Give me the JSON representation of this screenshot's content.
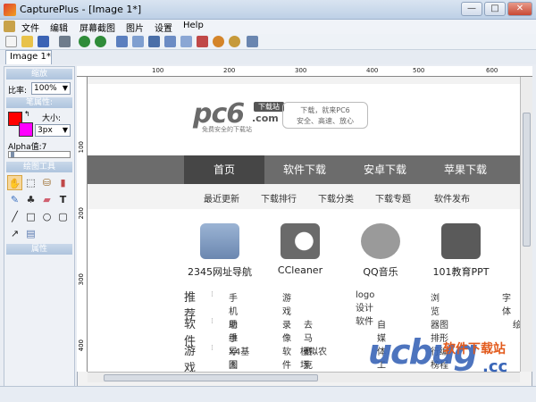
{
  "window": {
    "title": "CapturePlus - [Image 1*]",
    "min": "—",
    "max": "□",
    "close": "✕"
  },
  "menu": [
    "文件",
    "编辑",
    "屏幕截图",
    "图片",
    "设置",
    "Help"
  ],
  "tab": {
    "label": "Image 1*"
  },
  "panel": {
    "zoom_section": "缩放",
    "zoom_label": "比率:",
    "zoom_value": "100%",
    "props_section": "笔属性:",
    "size_label": "大小:",
    "size_value": "3px",
    "alpha_label": "Alpha值:7",
    "tools_section": "绘图工具",
    "attr_section": "属性"
  },
  "rulers": {
    "top": [
      "100",
      "200",
      "300",
      "400",
      "500",
      "600"
    ],
    "left": [
      "100",
      "200",
      "300",
      "400"
    ]
  },
  "colors": {
    "primary": "#ff0000",
    "secondary": "#ff00ff"
  },
  "page": {
    "logo": "pc6",
    "logo_badge": "下载站",
    "logo_com": ".com",
    "logo_slogan": "免费安全的下载站",
    "slogan_line1": "下载，就来PC6",
    "slogan_line2": "安全、高速、放心",
    "nav": [
      "首页",
      "软件下载",
      "安卓下载",
      "苹果下载"
    ],
    "subnav": [
      "最近更新",
      "下载排行",
      "下载分类",
      "下载专题",
      "软件发布"
    ],
    "apps": [
      {
        "name": "2345网址导航",
        "icon": "2345-logo-icon"
      },
      {
        "name": "CCleaner",
        "icon": "ccleaner-icon"
      },
      {
        "name": "QQ音乐",
        "icon": "qq-music-icon"
      },
      {
        "name": "101教育PPT",
        "icon": "101-ppt-icon"
      }
    ],
    "rows": [
      {
        "title": "推荐",
        "links": [
          "手机助手",
          "游戏录像软件",
          "logo设计软件",
          "浏览器排行榜",
          "字体"
        ]
      },
      {
        "title": "软件",
        "links": [
          "思维导图软件",
          "去马赛克软件",
          "自媒体工具",
          "图形编程软件",
          "绘"
        ]
      },
      {
        "title": "游戏",
        "links": [
          "X4基因MOD",
          "模拟农场19MOD",
          "",
          ""
        ]
      }
    ]
  },
  "watermark": {
    "main": "ucbug",
    "cc": ".cc",
    "sub": "软件下载站"
  }
}
